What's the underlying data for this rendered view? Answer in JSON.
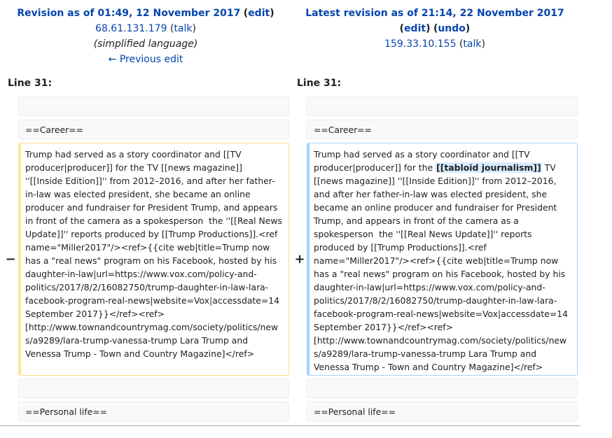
{
  "left": {
    "title": "Revision as of 01:49, 12 November 2017",
    "edit_label": "edit",
    "user": "68.61.131.179",
    "talk": "talk",
    "summary": "(simplified language)",
    "prev_edit": "← Previous edit",
    "line_label": "Line 31:",
    "marker": "−",
    "cells": {
      "blank1": "",
      "career": "==Career==",
      "changed": "Trump had served as a story coordinator and [[TV producer|producer]] for the TV [[news magazine]] ''[[Inside Edition]]'' from 2012–2016, and after her father-in-law was elected president, she became an online producer and fundraiser for President Trump, and appears in front of the camera as a spokesperson  the ''[[Real News Update]]'' reports produced by [[Trump Productions]].<ref name=\"Miller2017\"/><ref>{{cite web|title=Trump now has a \"real news\" program on his Facebook, hosted by his daughter-in-law|url=https://www.vox.com/policy-and-politics/2017/8/2/16082750/trump-daughter-in-law-lara-facebook-program-real-news|website=Vox|accessdate=14 September 2017}}</ref><ref>[http://www.townandcountrymag.com/society/politics/news/a9289/lara-trump-vanessa-trump Lara Trump and Venessa Trump - Town and Country Magazine]</ref>",
      "blank2": "",
      "personal": "==Personal life=="
    }
  },
  "right": {
    "title": "Latest revision as of 21:14, 22 November 2017",
    "edit_label": "edit",
    "undo_label": "undo",
    "user": "159.33.10.155",
    "talk": "talk",
    "line_label": "Line 31:",
    "marker": "+",
    "cells": {
      "blank1": "",
      "career": "==Career==",
      "changed_before": "Trump had served as a story coordinator and [[TV producer|producer]] for the ",
      "changed_highlight": "[[tabloid journalism]]",
      "changed_after": " TV [[news magazine]] ''[[Inside Edition]]'' from 2012–2016, and after her father-in-law was elected president, she became an online producer and fundraiser for President Trump, and appears in front of the camera as a spokesperson  the ''[[Real News Update]]'' reports produced by [[Trump Productions]].<ref name=\"Miller2017\"/><ref>{{cite web|title=Trump now has a \"real news\" program on his Facebook, hosted by his daughter-in-law|url=https://www.vox.com/policy-and-politics/2017/8/2/16082750/trump-daughter-in-law-lara-facebook-program-real-news|website=Vox|accessdate=14 September 2017}}</ref><ref>[http://www.townandcountrymag.com/society/politics/news/a9289/lara-trump-vanessa-trump Lara Trump and Venessa Trump - Town and Country Magazine]</ref>",
      "blank2": "",
      "personal": "==Personal life=="
    }
  },
  "colors": {
    "link": "#0645ad",
    "deleted_border": "#ffe49c",
    "added_border": "#a3d3ff",
    "highlight": "#d8ecff",
    "context_bg": "#f8f9fa"
  }
}
